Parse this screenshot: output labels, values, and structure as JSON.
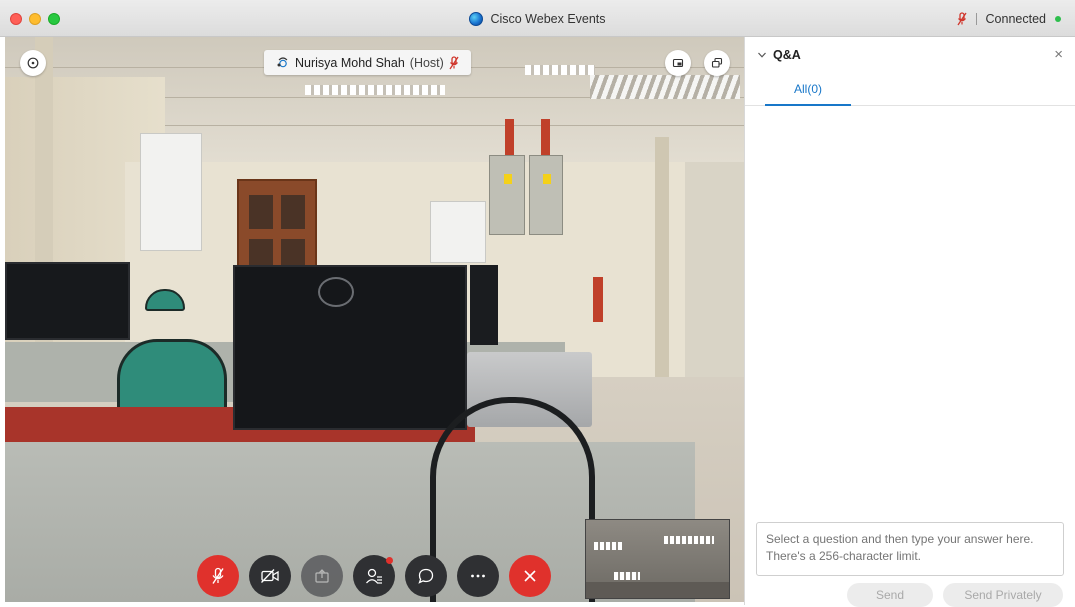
{
  "window": {
    "title": "Cisco Webex Events",
    "connection_status": "Connected",
    "status_dot_color": "#2dbe4c",
    "mic_status_icon": "mic-muted-icon"
  },
  "video": {
    "participant_name": "Nurisya Mohd Shah",
    "participant_role": "(Host)",
    "participant_muted": true,
    "controls": [
      {
        "name": "mute-button",
        "icon": "mic-muted-icon",
        "color": "#e0312c"
      },
      {
        "name": "stop-video-button",
        "icon": "video-off-icon",
        "color": "#2f3033"
      },
      {
        "name": "share-button",
        "icon": "share-icon",
        "color": "#5a5b5e"
      },
      {
        "name": "participants-button",
        "icon": "participants-icon",
        "color": "#2f3033"
      },
      {
        "name": "chat-button",
        "icon": "chat-icon",
        "color": "#2f3033"
      },
      {
        "name": "more-options-button",
        "icon": "ellipsis-icon",
        "color": "#2f3033"
      },
      {
        "name": "leave-button",
        "icon": "close-icon",
        "color": "#e0312c"
      }
    ]
  },
  "qa": {
    "title": "Q&A",
    "tab_all": "All(0)",
    "answer_placeholder": "Select a question and then type your answer here. There's a 256-character limit.",
    "send_label": "Send",
    "send_privately_label": "Send Privately",
    "accent_color": "#1877c9"
  }
}
